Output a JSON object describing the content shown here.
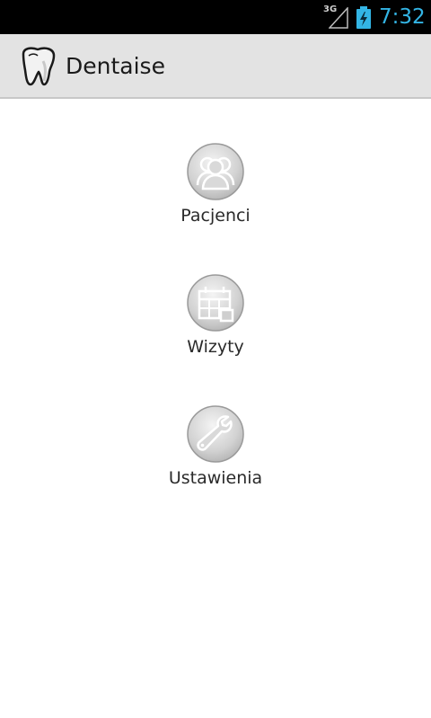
{
  "status_bar": {
    "network": "3G",
    "time": "7:32",
    "signal_icon": "signal-strength-icon",
    "battery_icon": "battery-charging-icon",
    "accent_color": "#33b5e5"
  },
  "action_bar": {
    "title": "Dentaise",
    "logo_icon": "tooth-icon"
  },
  "menu": {
    "items": [
      {
        "label": "Pacjenci",
        "icon": "patients-icon"
      },
      {
        "label": "Wizyty",
        "icon": "calendar-icon"
      },
      {
        "label": "Ustawienia",
        "icon": "wrench-icon"
      }
    ]
  }
}
